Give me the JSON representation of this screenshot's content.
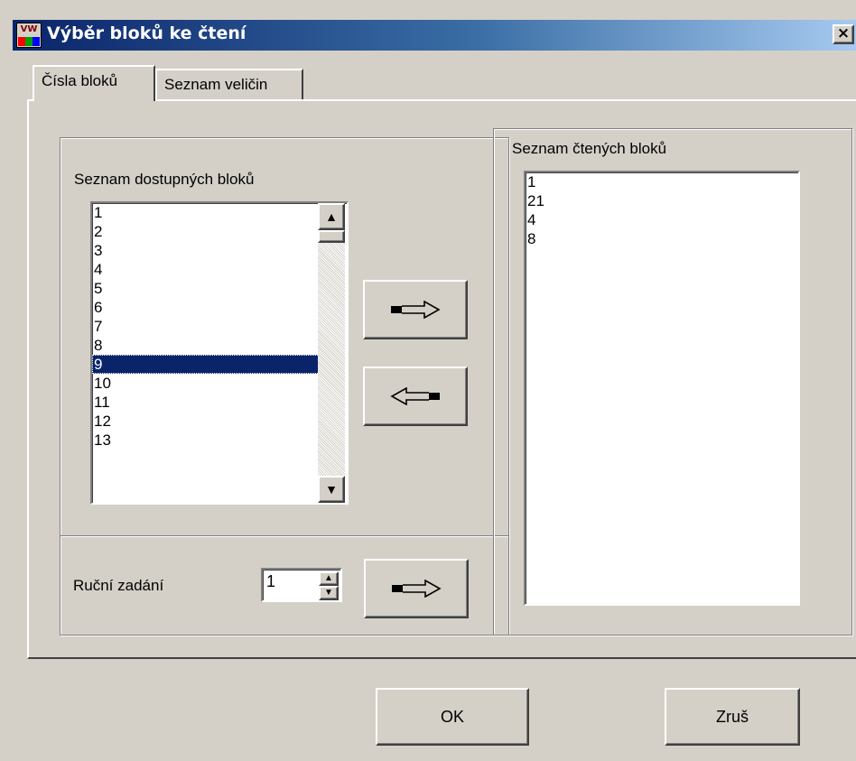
{
  "window": {
    "title": "Výběr bloků ke čtení",
    "icon": "vw-app-icon",
    "close_label": "×"
  },
  "tabs": [
    {
      "label": "Čísla bloků",
      "active": true
    },
    {
      "label": "Seznam veličin",
      "active": false
    }
  ],
  "available": {
    "label": "Seznam dostupných bloků",
    "items": [
      "1",
      "2",
      "3",
      "4",
      "5",
      "6",
      "7",
      "8",
      "9",
      "10",
      "11",
      "12",
      "13"
    ],
    "selected": "9"
  },
  "read": {
    "label": "Seznam čtených bloků",
    "items": [
      "1",
      "21",
      "4",
      "8"
    ]
  },
  "manual": {
    "label": "Ruční zadání",
    "value": "1"
  },
  "buttons": {
    "add_icon": "arrow-right-icon",
    "remove_icon": "arrow-left-icon",
    "ok_label": "OK",
    "cancel_label": "Zruš"
  }
}
